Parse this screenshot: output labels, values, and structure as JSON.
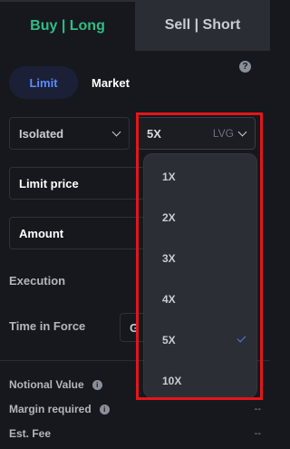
{
  "tabs": {
    "buy": "Buy | Long",
    "sell": "Sell | Short"
  },
  "help_icon": "?",
  "order_types": {
    "limit": "Limit",
    "market": "Market"
  },
  "margin_mode": {
    "value": "Isolated"
  },
  "leverage": {
    "value": "5X",
    "unit": "LVG",
    "options": [
      "1X",
      "2X",
      "3X",
      "4X",
      "5X",
      "10X"
    ],
    "selected": "5X"
  },
  "fields": {
    "limit_price": "Limit price",
    "amount": "Amount"
  },
  "execution": {
    "label": "Execution"
  },
  "time_in_force": {
    "label": "Time in Force",
    "value": "G"
  },
  "info": {
    "notional_label": "Notional Value",
    "margin_label": "Margin required",
    "margin_value": "--",
    "fee_label": "Est. Fee",
    "fee_value": "--",
    "info_glyph": "i"
  },
  "colors": {
    "buy": "#2fbd85",
    "accent": "#5a8cff",
    "highlight": "#e3161b"
  }
}
